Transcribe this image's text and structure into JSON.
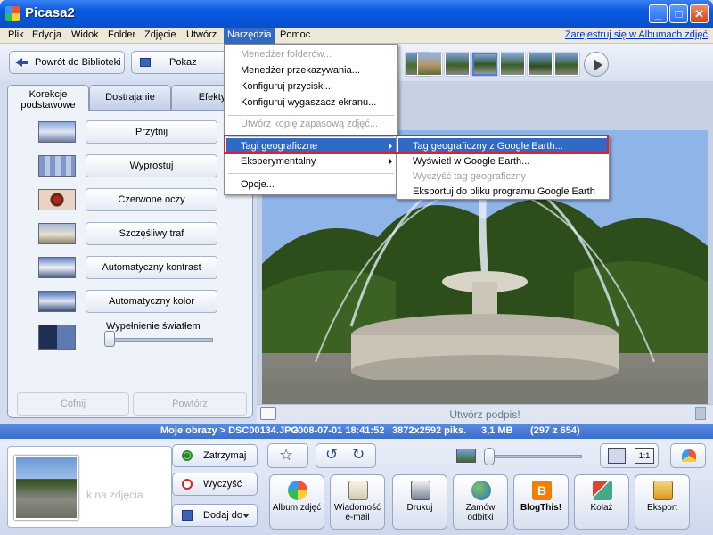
{
  "window": {
    "title": "Picasa2"
  },
  "menubar": {
    "items": [
      "Plik",
      "Edycja",
      "Widok",
      "Folder",
      "Zdjęcie",
      "Utwórz",
      "Narzędzia",
      "Pomoc"
    ],
    "active": "Narzędzia",
    "register_link": "Zarejestruj się w Albumach zdjęć"
  },
  "toolbar": {
    "back_label": "Powrót do Biblioteki",
    "slideshow_label": "Pokaz slajdów"
  },
  "tools_menu": {
    "items": [
      {
        "label": "Menedżer folderów...",
        "disabled": true
      },
      {
        "label": "Menedżer przekazywania...",
        "disabled": false
      },
      {
        "label": "Konfiguruj przyciski...",
        "disabled": false
      },
      {
        "label": "Konfiguruj wygaszacz ekranu...",
        "disabled": false
      },
      {
        "label": "Utwórz kopię zapasową zdjęć...",
        "disabled": true
      },
      {
        "label": "Tagi geograficzne",
        "disabled": false,
        "submenu": true,
        "highlighted": true
      },
      {
        "label": "Eksperymentalny",
        "disabled": false,
        "submenu": true
      },
      {
        "label": "Opcje...",
        "disabled": false
      }
    ]
  },
  "geo_submenu": {
    "items": [
      {
        "label": "Tag geograficzny z Google Earth...",
        "highlighted": true
      },
      {
        "label": "Wyświetl w Google Earth...",
        "disabled": false
      },
      {
        "label": "Wyczyść tag geograficzny",
        "disabled": true
      },
      {
        "label": "Eksportuj do pliku programu Google Earth",
        "disabled": false
      }
    ]
  },
  "left_panel": {
    "tabs": [
      "Korekcje podstawowe",
      "Dostrajanie",
      "Efekty"
    ],
    "tools": [
      "Przytnij",
      "Wyprostuj",
      "Czerwone oczy",
      "Szczęśliwy traf",
      "Automatyczny kontrast",
      "Automatyczny kolor"
    ],
    "fill_light_label": "Wypełnienie światłem",
    "fill_light_value": 0,
    "undo_label": "Cofnij",
    "redo_label": "Powtórz"
  },
  "photo": {
    "caption_placeholder": "Utwórz podpis!"
  },
  "status": {
    "path": "Moje obrazy > DSC00134.JPG",
    "date": "2008-07-01 18:41:52",
    "dimensions": "3872x2592 piks.",
    "size": "3,1 MB",
    "position": "(297 z 654)"
  },
  "tray": {
    "hint": "k na zdjęcia",
    "hold_label": "Zatrzymaj",
    "clear_label": "Wyczyść",
    "add_label": "Dodaj do",
    "actions": [
      "Album zdjęć",
      "Wiadomość e-mail",
      "Drukuj",
      "Zamów odbitki",
      "BlogThis!",
      "Kolaż",
      "Eksport"
    ]
  },
  "colors": {
    "titlebar": "#0653d5",
    "menu_highlight": "#316ac5",
    "highlight_frame": "#e0202c",
    "status_bar": "#3b6fcf"
  }
}
